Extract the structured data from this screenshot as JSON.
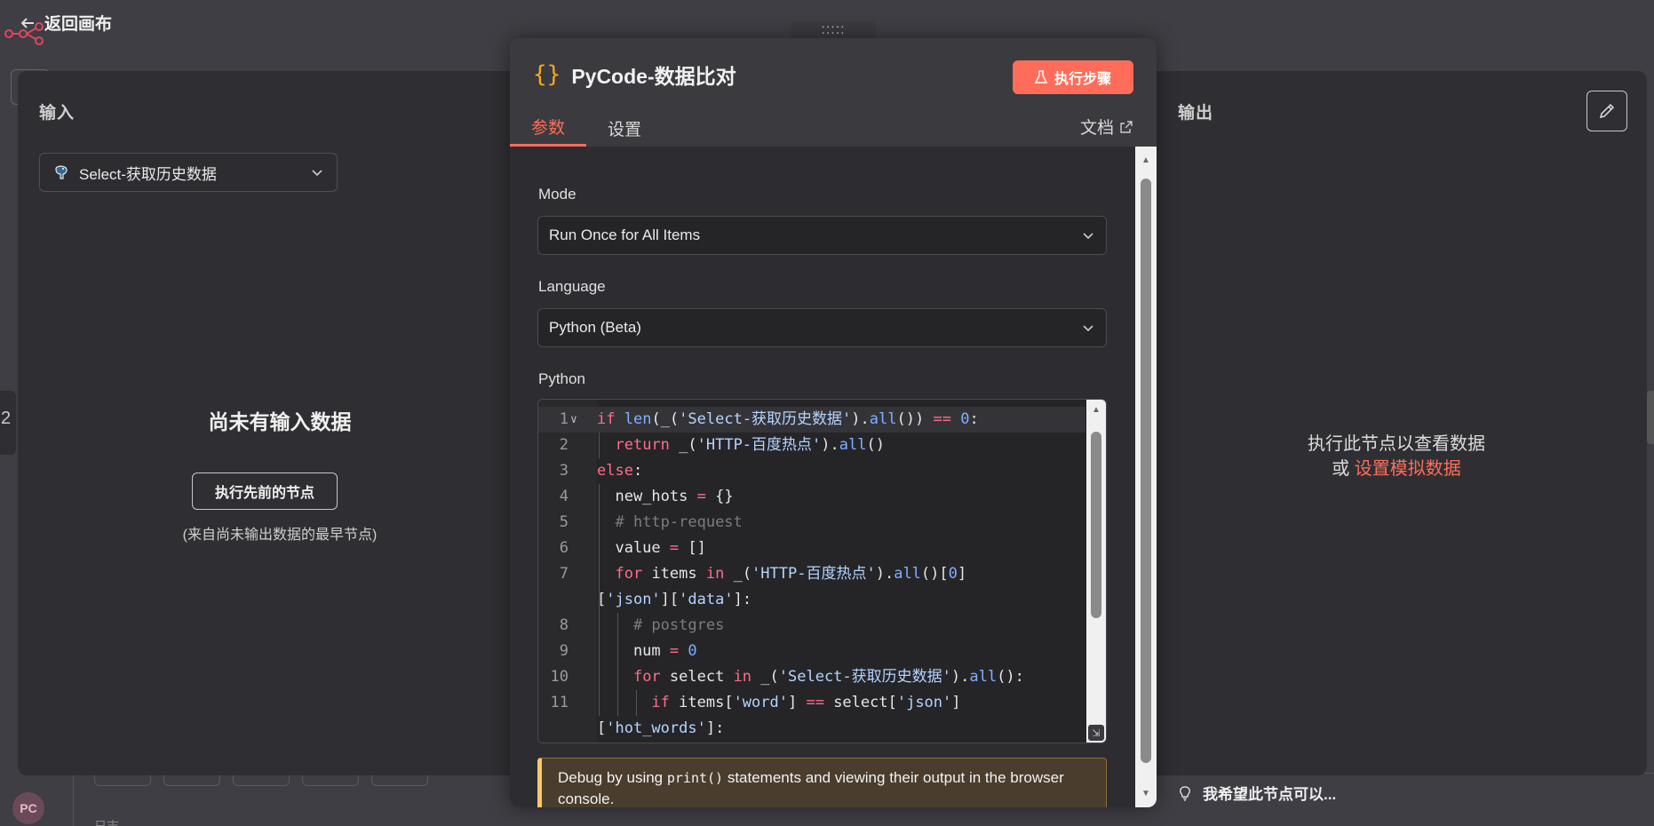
{
  "header": {
    "back_label": "返回画布"
  },
  "input_panel": {
    "title": "输入",
    "selected_node": "Select-获取历史数据",
    "empty_title": "尚未有输入数据",
    "exec_prev_label": "执行先前的节点",
    "empty_hint": "(来自尚未输出数据的最早节点)"
  },
  "output_panel": {
    "title": "输出",
    "msg_line1": "执行此节点以查看数据",
    "msg_or": "或 ",
    "msg_link": "设置模拟数据",
    "wish": "我希望此节点可以..."
  },
  "node": {
    "title": "PyCode-数据比对",
    "exec_step_label": "执行步骤",
    "tabs": [
      {
        "label": "参数"
      },
      {
        "label": "设置"
      }
    ],
    "docs_label": "文档"
  },
  "params": {
    "mode": {
      "label": "Mode",
      "value": "Run Once for All Items"
    },
    "language": {
      "label": "Language",
      "value": "Python (Beta)"
    },
    "code_label": "Python",
    "debug_before": "Debug by using ",
    "debug_code": "print()",
    "debug_after": " statements and viewing their output in the browser console."
  },
  "code_lines": [
    "1",
    "2",
    "3",
    "4",
    "5",
    "6",
    "7",
    "",
    "8",
    "9",
    "10",
    "11",
    ""
  ],
  "backdrop": {
    "avatar": "PC",
    "log_label": "日志",
    "edge_glyph": "2"
  },
  "colors": {
    "accent": "#ff6d5a",
    "brace": "#f6a623",
    "panel": "#2f2f33",
    "modal": "#2d2d31"
  },
  "icons": [
    "arrow-left-icon",
    "n8n-logo-icon",
    "postgres-elephant-icon",
    "chevron-down-icon",
    "flask-icon",
    "external-link-icon",
    "pencil-icon",
    "lightbulb-icon",
    "fold-chevron-icon",
    "resize-icon"
  ]
}
